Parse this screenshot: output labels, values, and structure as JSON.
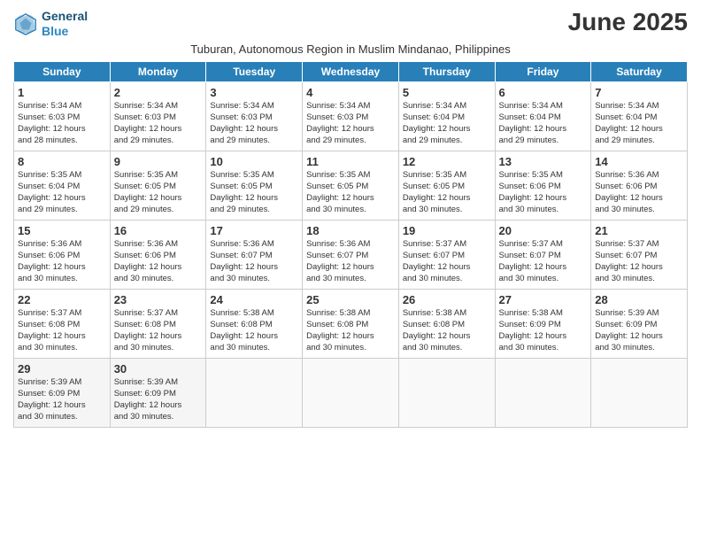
{
  "header": {
    "logo_line1": "General",
    "logo_line2": "Blue",
    "month_title": "June 2025",
    "subtitle": "Tuburan, Autonomous Region in Muslim Mindanao, Philippines"
  },
  "days_of_week": [
    "Sunday",
    "Monday",
    "Tuesday",
    "Wednesday",
    "Thursday",
    "Friday",
    "Saturday"
  ],
  "weeks": [
    [
      {
        "day": 1,
        "lines": [
          "Sunrise: 5:34 AM",
          "Sunset: 6:03 PM",
          "Daylight: 12 hours",
          "and 28 minutes."
        ]
      },
      {
        "day": 2,
        "lines": [
          "Sunrise: 5:34 AM",
          "Sunset: 6:03 PM",
          "Daylight: 12 hours",
          "and 29 minutes."
        ]
      },
      {
        "day": 3,
        "lines": [
          "Sunrise: 5:34 AM",
          "Sunset: 6:03 PM",
          "Daylight: 12 hours",
          "and 29 minutes."
        ]
      },
      {
        "day": 4,
        "lines": [
          "Sunrise: 5:34 AM",
          "Sunset: 6:03 PM",
          "Daylight: 12 hours",
          "and 29 minutes."
        ]
      },
      {
        "day": 5,
        "lines": [
          "Sunrise: 5:34 AM",
          "Sunset: 6:04 PM",
          "Daylight: 12 hours",
          "and 29 minutes."
        ]
      },
      {
        "day": 6,
        "lines": [
          "Sunrise: 5:34 AM",
          "Sunset: 6:04 PM",
          "Daylight: 12 hours",
          "and 29 minutes."
        ]
      },
      {
        "day": 7,
        "lines": [
          "Sunrise: 5:34 AM",
          "Sunset: 6:04 PM",
          "Daylight: 12 hours",
          "and 29 minutes."
        ]
      }
    ],
    [
      {
        "day": 8,
        "lines": [
          "Sunrise: 5:35 AM",
          "Sunset: 6:04 PM",
          "Daylight: 12 hours",
          "and 29 minutes."
        ]
      },
      {
        "day": 9,
        "lines": [
          "Sunrise: 5:35 AM",
          "Sunset: 6:05 PM",
          "Daylight: 12 hours",
          "and 29 minutes."
        ]
      },
      {
        "day": 10,
        "lines": [
          "Sunrise: 5:35 AM",
          "Sunset: 6:05 PM",
          "Daylight: 12 hours",
          "and 29 minutes."
        ]
      },
      {
        "day": 11,
        "lines": [
          "Sunrise: 5:35 AM",
          "Sunset: 6:05 PM",
          "Daylight: 12 hours",
          "and 30 minutes."
        ]
      },
      {
        "day": 12,
        "lines": [
          "Sunrise: 5:35 AM",
          "Sunset: 6:05 PM",
          "Daylight: 12 hours",
          "and 30 minutes."
        ]
      },
      {
        "day": 13,
        "lines": [
          "Sunrise: 5:35 AM",
          "Sunset: 6:06 PM",
          "Daylight: 12 hours",
          "and 30 minutes."
        ]
      },
      {
        "day": 14,
        "lines": [
          "Sunrise: 5:36 AM",
          "Sunset: 6:06 PM",
          "Daylight: 12 hours",
          "and 30 minutes."
        ]
      }
    ],
    [
      {
        "day": 15,
        "lines": [
          "Sunrise: 5:36 AM",
          "Sunset: 6:06 PM",
          "Daylight: 12 hours",
          "and 30 minutes."
        ]
      },
      {
        "day": 16,
        "lines": [
          "Sunrise: 5:36 AM",
          "Sunset: 6:06 PM",
          "Daylight: 12 hours",
          "and 30 minutes."
        ]
      },
      {
        "day": 17,
        "lines": [
          "Sunrise: 5:36 AM",
          "Sunset: 6:07 PM",
          "Daylight: 12 hours",
          "and 30 minutes."
        ]
      },
      {
        "day": 18,
        "lines": [
          "Sunrise: 5:36 AM",
          "Sunset: 6:07 PM",
          "Daylight: 12 hours",
          "and 30 minutes."
        ]
      },
      {
        "day": 19,
        "lines": [
          "Sunrise: 5:37 AM",
          "Sunset: 6:07 PM",
          "Daylight: 12 hours",
          "and 30 minutes."
        ]
      },
      {
        "day": 20,
        "lines": [
          "Sunrise: 5:37 AM",
          "Sunset: 6:07 PM",
          "Daylight: 12 hours",
          "and 30 minutes."
        ]
      },
      {
        "day": 21,
        "lines": [
          "Sunrise: 5:37 AM",
          "Sunset: 6:07 PM",
          "Daylight: 12 hours",
          "and 30 minutes."
        ]
      }
    ],
    [
      {
        "day": 22,
        "lines": [
          "Sunrise: 5:37 AM",
          "Sunset: 6:08 PM",
          "Daylight: 12 hours",
          "and 30 minutes."
        ]
      },
      {
        "day": 23,
        "lines": [
          "Sunrise: 5:37 AM",
          "Sunset: 6:08 PM",
          "Daylight: 12 hours",
          "and 30 minutes."
        ]
      },
      {
        "day": 24,
        "lines": [
          "Sunrise: 5:38 AM",
          "Sunset: 6:08 PM",
          "Daylight: 12 hours",
          "and 30 minutes."
        ]
      },
      {
        "day": 25,
        "lines": [
          "Sunrise: 5:38 AM",
          "Sunset: 6:08 PM",
          "Daylight: 12 hours",
          "and 30 minutes."
        ]
      },
      {
        "day": 26,
        "lines": [
          "Sunrise: 5:38 AM",
          "Sunset: 6:08 PM",
          "Daylight: 12 hours",
          "and 30 minutes."
        ]
      },
      {
        "day": 27,
        "lines": [
          "Sunrise: 5:38 AM",
          "Sunset: 6:09 PM",
          "Daylight: 12 hours",
          "and 30 minutes."
        ]
      },
      {
        "day": 28,
        "lines": [
          "Sunrise: 5:39 AM",
          "Sunset: 6:09 PM",
          "Daylight: 12 hours",
          "and 30 minutes."
        ]
      }
    ],
    [
      {
        "day": 29,
        "lines": [
          "Sunrise: 5:39 AM",
          "Sunset: 6:09 PM",
          "Daylight: 12 hours",
          "and 30 minutes."
        ]
      },
      {
        "day": 30,
        "lines": [
          "Sunrise: 5:39 AM",
          "Sunset: 6:09 PM",
          "Daylight: 12 hours",
          "and 30 minutes."
        ]
      },
      null,
      null,
      null,
      null,
      null
    ]
  ]
}
